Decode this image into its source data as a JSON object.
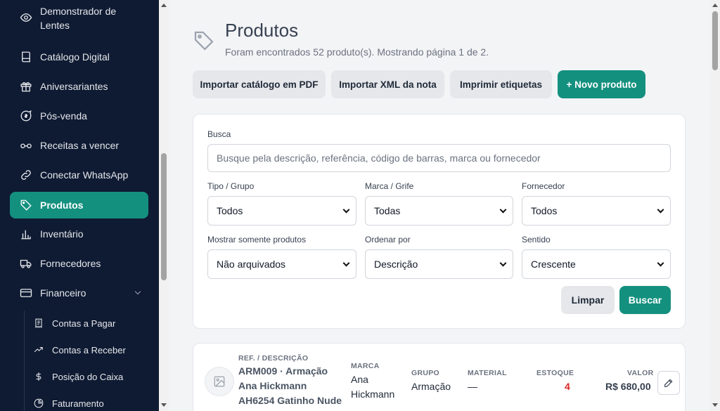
{
  "sidebar": {
    "items": [
      {
        "label": "Demonstrador de Lentes",
        "icon": "eye-icon"
      },
      {
        "label": "Catálogo Digital",
        "icon": "book-icon"
      },
      {
        "label": "Aniversariantes",
        "icon": "gift-icon"
      },
      {
        "label": "Pós-venda",
        "icon": "chat-dollar-icon"
      },
      {
        "label": "Receitas a vencer",
        "icon": "glasses-icon"
      },
      {
        "label": "Conectar WhatsApp",
        "icon": "link-icon"
      },
      {
        "label": "Produtos",
        "icon": "tag-icon"
      },
      {
        "label": "Inventário",
        "icon": "bar-chart-icon"
      },
      {
        "label": "Fornecedores",
        "icon": "truck-icon"
      },
      {
        "label": "Financeiro",
        "icon": "card-icon"
      }
    ],
    "sub_items": [
      {
        "label": "Contas a Pagar",
        "icon": "receipt-icon"
      },
      {
        "label": "Contas a Receber",
        "icon": "trending-up-icon"
      },
      {
        "label": "Posição do Caixa",
        "icon": "dollar-icon"
      },
      {
        "label": "Faturamento",
        "icon": "pie-icon"
      }
    ]
  },
  "header": {
    "title": "Produtos",
    "subtitle": "Foram encontrados 52 produto(s). Mostrando página 1 de 2."
  },
  "actions": {
    "import_pdf": "Importar catálogo em PDF",
    "import_xml": "Importar XML da nota",
    "print_labels": "Imprimir etiquetas",
    "new_product": "+ Novo produto"
  },
  "filters": {
    "search_label": "Busca",
    "search_placeholder": "Busque pela descrição, referência, código de barras, marca ou fornecedor",
    "type_label": "Tipo / Grupo",
    "type_value": "Todos",
    "brand_label": "Marca / Grife",
    "brand_value": "Todas",
    "supplier_label": "Fornecedor",
    "supplier_value": "Todos",
    "show_label": "Mostrar somente produtos",
    "show_value": "Não arquivados",
    "order_label": "Ordenar por",
    "order_value": "Descrição",
    "direction_label": "Sentido",
    "direction_value": "Crescente",
    "clear_label": "Limpar",
    "search_button": "Buscar"
  },
  "product": {
    "ref_header": "REF. / DESCRIÇÃO",
    "description": "ARM009 · Armação Ana Hickmann AH6254 Gatinho Nude",
    "brand_header": "MARCA",
    "brand": "Ana Hickmann",
    "group_header": "GRUPO",
    "group": "Armação",
    "material_header": "MATERIAL",
    "material": "—",
    "stock_header": "ESTOQUE",
    "stock": "4",
    "value_header": "VALOR",
    "value": "R$ 680,00"
  },
  "colors": {
    "sidebar_bg": "#0f1b33",
    "accent": "#14907f",
    "stock_alert": "#dc2626"
  }
}
